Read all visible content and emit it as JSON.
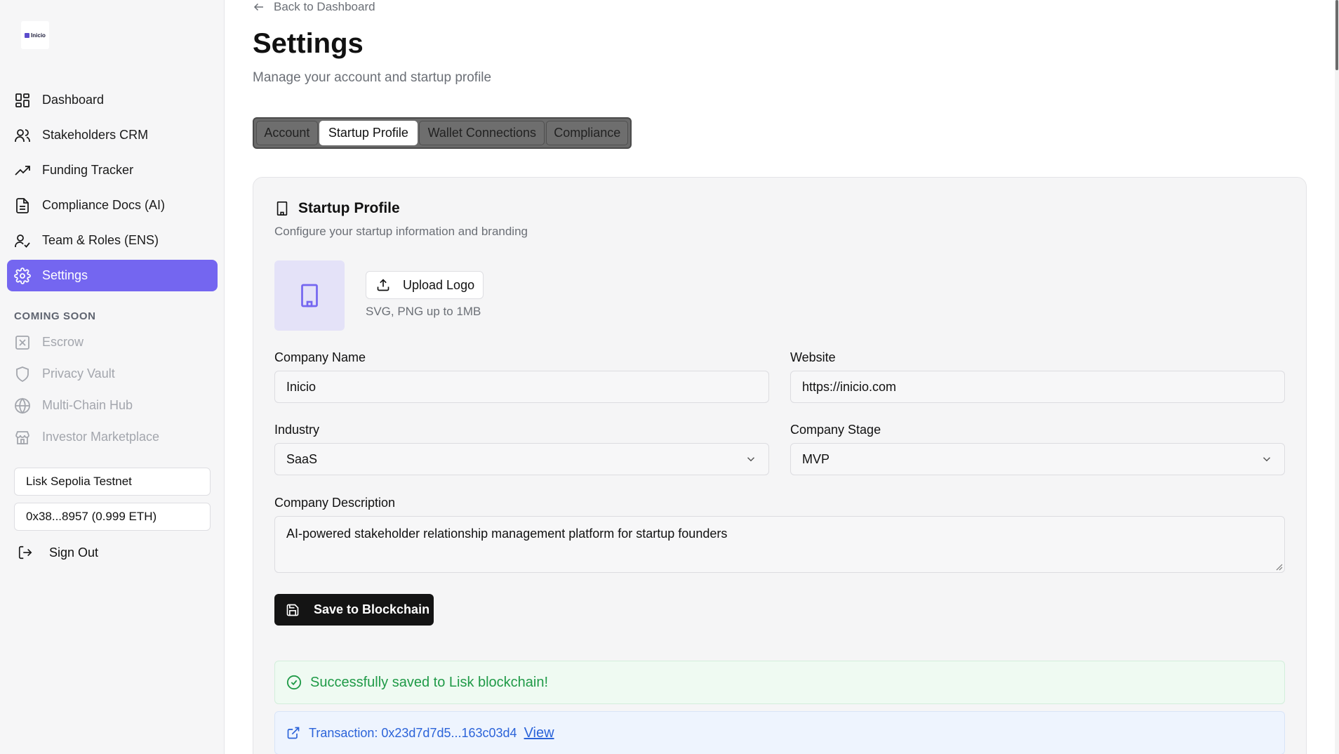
{
  "app": {
    "logo_text": "Inicio"
  },
  "sidebar": {
    "nav": [
      {
        "label": "Dashboard",
        "icon": "layout-grid-icon"
      },
      {
        "label": "Stakeholders CRM",
        "icon": "users-icon"
      },
      {
        "label": "Funding Tracker",
        "icon": "trending-up-icon"
      },
      {
        "label": "Compliance Docs (AI)",
        "icon": "file-text-icon"
      },
      {
        "label": "Team & Roles (ENS)",
        "icon": "user-check-icon"
      },
      {
        "label": "Settings",
        "icon": "gear-icon",
        "active": true
      }
    ],
    "coming_soon_heading": "COMING SOON",
    "coming_soon": [
      {
        "label": "Escrow",
        "icon": "x-square-icon"
      },
      {
        "label": "Privacy Vault",
        "icon": "shield-icon"
      },
      {
        "label": "Multi-Chain Hub",
        "icon": "globe-icon"
      },
      {
        "label": "Investor Marketplace",
        "icon": "store-icon"
      }
    ],
    "network": "Lisk Sepolia Testnet",
    "wallet": "0x38...8957 (0.999 ETH)",
    "sign_out": "Sign Out"
  },
  "header": {
    "back_label": "Back to Dashboard",
    "title": "Settings",
    "subtitle": "Manage your account and startup profile"
  },
  "tabs": [
    {
      "label": "Account",
      "active": false
    },
    {
      "label": "Startup Profile",
      "active": true
    },
    {
      "label": "Wallet Connections",
      "active": false
    },
    {
      "label": "Compliance",
      "active": false
    }
  ],
  "profile": {
    "title": "Startup Profile",
    "subtitle": "Configure your startup information and branding",
    "upload_label": "Upload Logo",
    "upload_hint": "SVG, PNG up to 1MB",
    "company_name_label": "Company Name",
    "company_name": "Inicio",
    "website_label": "Website",
    "website": "https://inicio.com",
    "industry_label": "Industry",
    "industry": "SaaS",
    "stage_label": "Company Stage",
    "stage": "MVP",
    "description_label": "Company Description",
    "description": "AI-powered stakeholder relationship management platform for startup founders",
    "save_label": "Save to Blockchain"
  },
  "status": {
    "success": "Successfully saved to Lisk blockchain!",
    "tx_label": "Transaction: 0x23d7d7d5...163c03d4",
    "view_label": "View"
  },
  "colors": {
    "accent": "#7466f0",
    "success": "#1f9a47",
    "link": "#2b63d9"
  }
}
